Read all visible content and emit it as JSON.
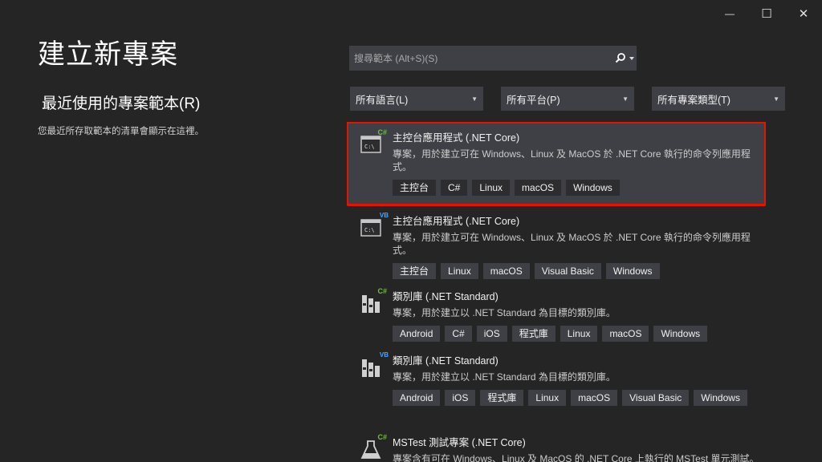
{
  "window": {
    "controls": {
      "minimize": "—",
      "maximize": "☐",
      "close": "✕"
    }
  },
  "page": {
    "title": "建立新專案",
    "recent_heading": "最近使用的專案範本(R)",
    "recent_empty": "您最近所存取範本的清單會顯示在這裡。"
  },
  "search": {
    "placeholder": "搜尋範本 (Alt+S)(S)",
    "icon": "search-icon"
  },
  "filters": {
    "language": "所有語言(L)",
    "platform": "所有平台(P)",
    "project_type": "所有專案類型(T)"
  },
  "templates": [
    {
      "name": "主控台應用程式 (.NET Core)",
      "description": "專案，用於建立可在 Windows、Linux 及 MacOS 於 .NET Core 執行的命令列應用程式。",
      "lang_badge": "C#",
      "tags": [
        "主控台",
        "C#",
        "Linux",
        "macOS",
        "Windows"
      ]
    },
    {
      "name": "主控台應用程式 (.NET Core)",
      "description": "專案，用於建立可在 Windows、Linux 及 MacOS 於 .NET Core 執行的命令列應用程式。",
      "lang_badge": "VB",
      "tags": [
        "主控台",
        "Linux",
        "macOS",
        "Visual Basic",
        "Windows"
      ]
    },
    {
      "name": "類別庫 (.NET Standard)",
      "description": "專案，用於建立以 .NET Standard 為目標的類別庫。",
      "lang_badge": "C#",
      "tags": [
        "Android",
        "C#",
        "iOS",
        "程式庫",
        "Linux",
        "macOS",
        "Windows"
      ]
    },
    {
      "name": "類別庫 (.NET Standard)",
      "description": "專案，用於建立以 .NET Standard 為目標的類別庫。",
      "lang_badge": "VB",
      "tags": [
        "Android",
        "iOS",
        "程式庫",
        "Linux",
        "macOS",
        "Visual Basic",
        "Windows"
      ]
    },
    {
      "name": "MSTest 測試專案 (.NET Core)",
      "description": "專案含有可在 Windows、Linux 及 MacOS 的 .NET Core 上執行的 MSTest 單元測試。",
      "lang_badge": "C#",
      "tags": []
    }
  ],
  "colors": {
    "background": "#252526",
    "panel": "#3f3f46",
    "selection_border": "#e51400",
    "csharp_badge": "#6fbf40",
    "vb_badge": "#4fa3ff"
  }
}
